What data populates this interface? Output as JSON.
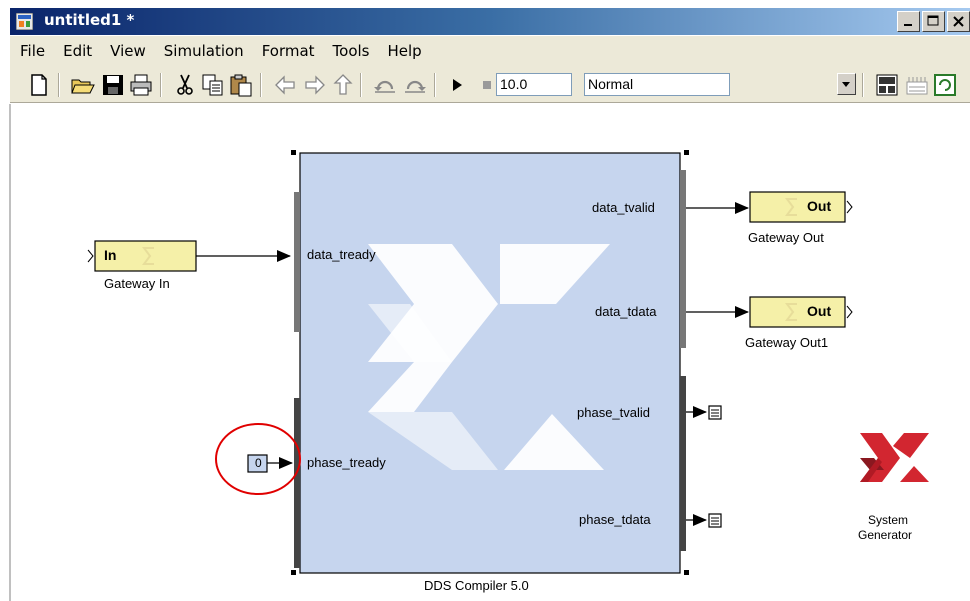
{
  "window": {
    "title": "untitled1 *",
    "icons": {
      "app": "simulink-model-icon",
      "minimize": "minimize-icon",
      "maximize": "maximize-icon",
      "close": "close-icon"
    }
  },
  "menu": [
    "File",
    "Edit",
    "View",
    "Simulation",
    "Format",
    "Tools",
    "Help"
  ],
  "toolbar": {
    "buttons": [
      "new-icon",
      "open-icon",
      "save-icon",
      "print-icon",
      "cut-icon",
      "copy-icon",
      "paste-icon",
      "back-icon",
      "forward-icon",
      "up-icon",
      "undo-icon",
      "redo-icon",
      "start-icon",
      "stop-icon",
      "library-browser-icon",
      "model-explorer-icon",
      "debug-icon"
    ],
    "stop_time": "10.0",
    "sim_mode": "Normal"
  },
  "blocks": {
    "gateway_in": {
      "label": "Gateway In",
      "text": "In"
    },
    "gateway_out": {
      "label": "Gateway Out",
      "text": "Out"
    },
    "gateway_out1": {
      "label": "Gateway Out1",
      "text": "Out"
    },
    "constant": {
      "value": "0"
    },
    "dds": {
      "label": "DDS Compiler 5.0",
      "inputs": [
        "data_tready",
        "phase_tready"
      ],
      "outputs": [
        "data_tvalid",
        "data_tdata",
        "phase_tvalid",
        "phase_tdata"
      ]
    },
    "sysgen": {
      "label_line1": "System",
      "label_line2": "Generator"
    }
  },
  "colors": {
    "block_fill": "#c6d5ee",
    "gateway_fill": "#f5f0a8",
    "xilinx_red": "#d22630",
    "annotation_circle": "#e00000"
  }
}
